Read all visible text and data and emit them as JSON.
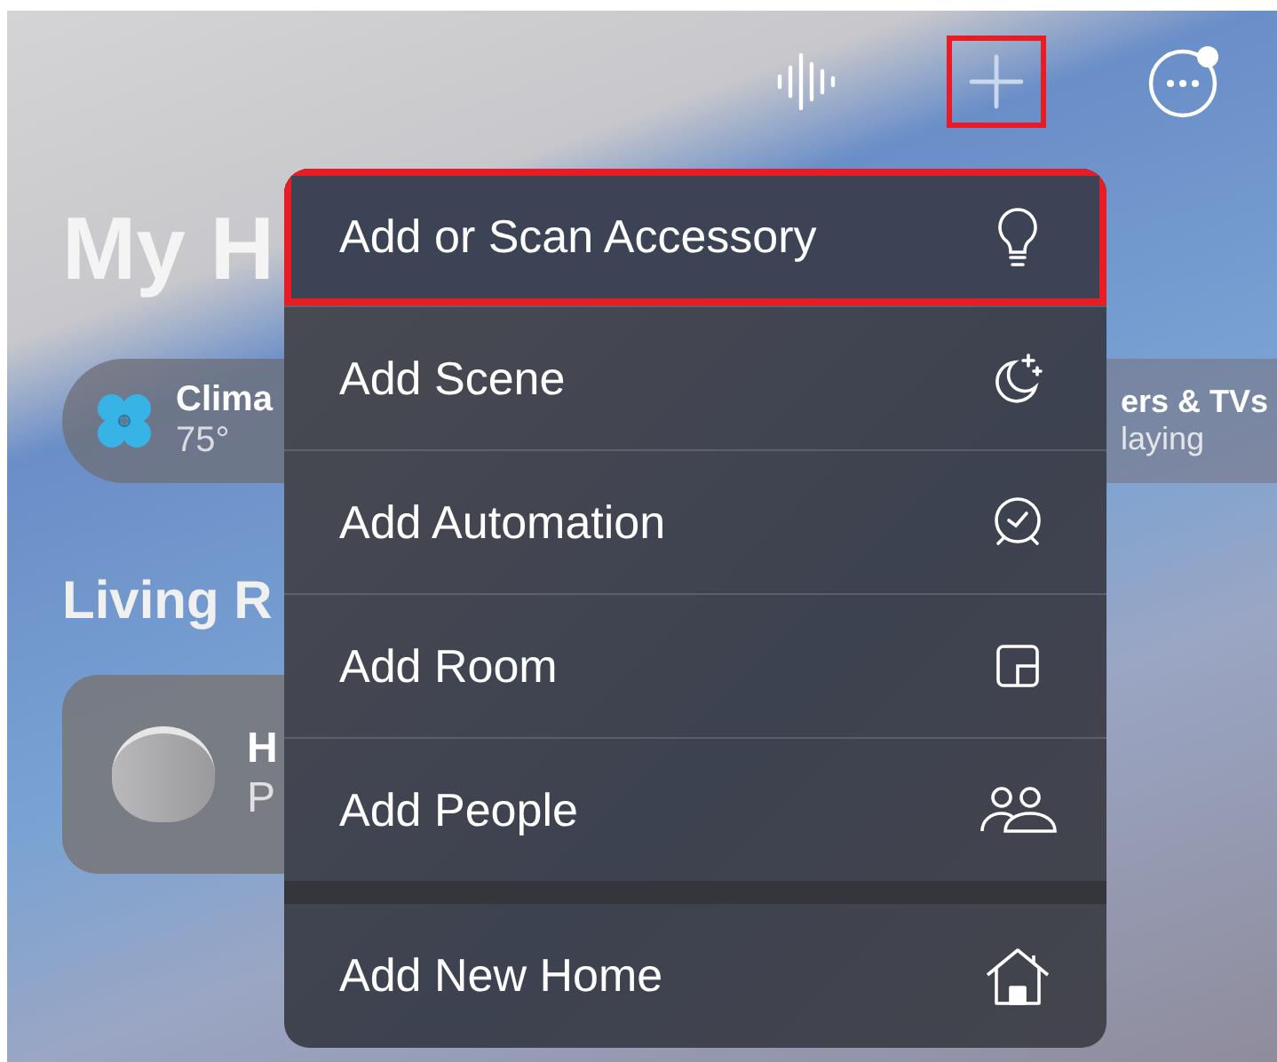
{
  "toolbar": [
    {
      "kind": "waveform",
      "highlighted": false
    },
    {
      "kind": "add",
      "highlighted": true
    },
    {
      "kind": "more",
      "highlighted": false
    }
  ],
  "home": {
    "title": "My H",
    "summary_pills": [
      {
        "kind": "climate",
        "title": "Clima",
        "subtitle": "75°"
      },
      {
        "kind": "media",
        "title": "ers & TVs",
        "subtitle": "laying"
      }
    ],
    "section_title": "Living R",
    "accessory": {
      "title": "H",
      "subtitle": "P"
    }
  },
  "menu": {
    "items": [
      {
        "label": "Add or Scan Accessory",
        "kind": "bulb",
        "highlighted": true,
        "group_start": false
      },
      {
        "label": "Add Scene",
        "kind": "scene",
        "highlighted": false,
        "group_start": false
      },
      {
        "label": "Add Automation",
        "kind": "clock",
        "highlighted": false,
        "group_start": false
      },
      {
        "label": "Add Room",
        "kind": "room",
        "highlighted": false,
        "group_start": false
      },
      {
        "label": "Add People",
        "kind": "people",
        "highlighted": false,
        "group_start": false
      },
      {
        "label": "Add New Home",
        "kind": "house",
        "highlighted": false,
        "group_start": true
      }
    ]
  }
}
